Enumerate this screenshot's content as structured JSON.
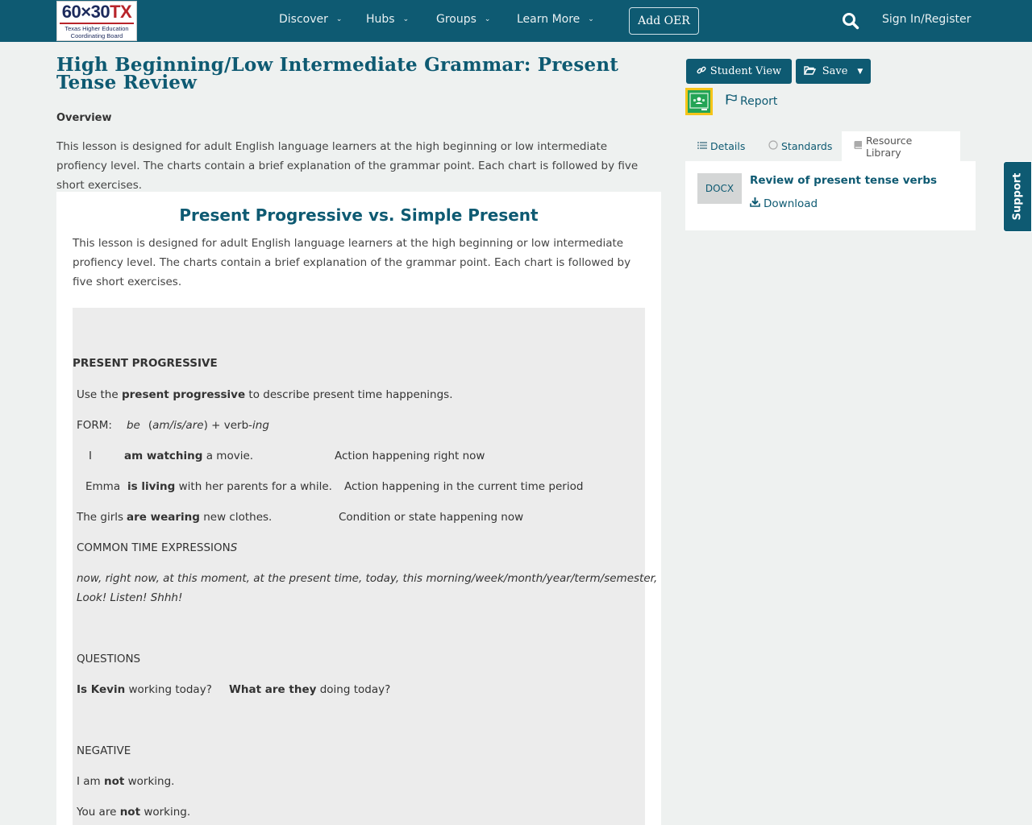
{
  "nav": {
    "logo_main_a": "60×30",
    "logo_main_b": "TX",
    "logo_sub_1": "Texas Higher Education",
    "logo_sub_2": "Coordinating Board",
    "items": [
      {
        "label": "Discover"
      },
      {
        "label": "Hubs"
      },
      {
        "label": "Groups"
      },
      {
        "label": "Learn More"
      }
    ],
    "add_oer": "Add OER",
    "sign_in": "Sign In/Register"
  },
  "page": {
    "title": "High Beginning/Low Intermediate Grammar: Present Tense Review",
    "overview_label": "Overview",
    "overview_text": "This lesson is designed for adult English language learners at the high beginning or low intermediate profiency level. The charts contain a brief explanation of the grammar point. Each chart is followed by five short exercises."
  },
  "content": {
    "heading": "Present Progressive vs. Simple Present",
    "intro": "This lesson is designed for adult English language learners at the high beginning or low intermediate profiency level. The charts contain a brief explanation of the grammar point. Each chart is followed by five short exercises.",
    "section_title": "PRESENT PROGRESSIVE",
    "use_a": "Use the ",
    "use_b": "present progressive",
    "use_c": " to describe present time happenings.",
    "form_a": "FORM:",
    "form_b": "be",
    "form_c": "(",
    "form_d": "am/is/are",
    "form_e": ") + verb-",
    "form_f": "ing",
    "ex1_subj": "I",
    "ex1_verb": "am watching",
    "ex1_rest": " a movie.",
    "ex1_note": "Action happening right now",
    "ex2_subj": "Emma",
    "ex2_verb": "is living",
    "ex2_rest": " with her parents for a while.",
    "ex2_note": "Action happening in the current time period",
    "ex3_subj": "The girls",
    "ex3_verb": "are wearing",
    "ex3_rest": " new clothes.",
    "ex3_note": "Condition or state happening now",
    "cte_a": "COMMON TIME EXPRESSION",
    "cte_b": "S",
    "cte_line1": "now, right now, at this moment, at the present time, today, this morning/week/month/year/term/semester,",
    "cte_line2": "Look!  Listen!  Shhh!",
    "questions": "QUESTIONS",
    "q1_a": "Is Kevin",
    "q1_b": " working today?",
    "q2_a": "What are they",
    "q2_b": " doing today?",
    "negative": "NEGATIVE",
    "n1_a": "I am ",
    "n1_b": "not",
    "n1_c": " working.",
    "n2_a": "You are ",
    "n2_b": "not",
    "n2_c": " working."
  },
  "sidebar": {
    "student_view": "Student View",
    "save": "Save",
    "report": "Report",
    "tabs": [
      {
        "label": "Details"
      },
      {
        "label": "Standards"
      },
      {
        "label": "Resource Library"
      }
    ],
    "resource": {
      "type": "DOCX",
      "title": "Review of present tense verbs",
      "download": "Download"
    },
    "support": "Support"
  },
  "colors": {
    "brand": "#0e5a72",
    "accent_red": "#b8242a",
    "classroom_green": "#23a455",
    "classroom_yellow": "#f5c518"
  }
}
